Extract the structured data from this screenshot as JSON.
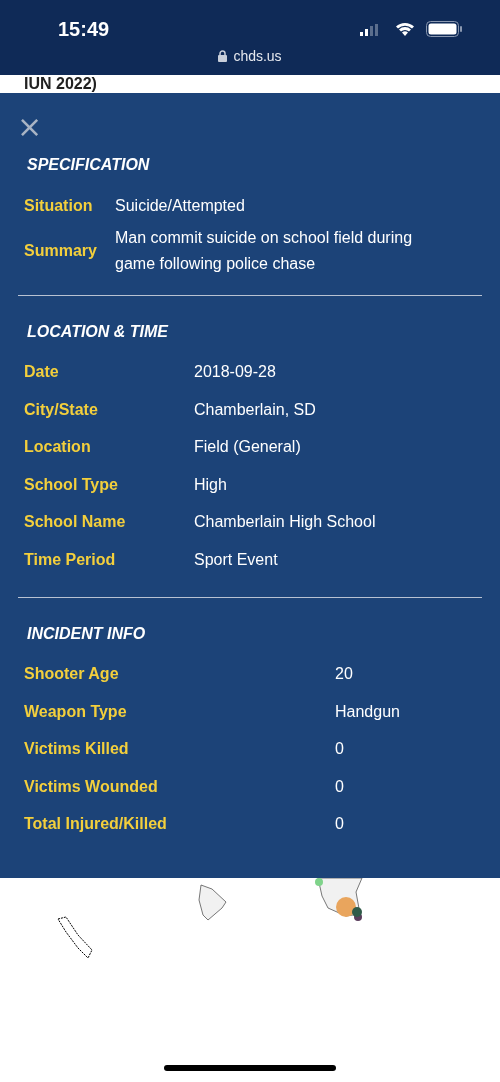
{
  "status_bar": {
    "time": "15:49",
    "url": "chds.us"
  },
  "page_title_fragment": "IUN 2022)",
  "modal": {
    "close": "×",
    "sections": [
      {
        "title": "SPECIFICATION",
        "kind": "summary",
        "rows": [
          {
            "label": "Situation",
            "value": "Suicide/Attempted"
          },
          {
            "label": "Summary",
            "value": "Man commit suicide on school field during game following police chase"
          }
        ]
      },
      {
        "title": "LOCATION & TIME",
        "kind": "details",
        "rows": [
          {
            "label": "Date",
            "value": "2018-09-28"
          },
          {
            "label": "City/State",
            "value": "Chamberlain, SD"
          },
          {
            "label": "Location",
            "value": "Field (General)"
          },
          {
            "label": "School Type",
            "value": "High"
          },
          {
            "label": "School Name",
            "value": "Chamberlain High School"
          },
          {
            "label": "Time Period",
            "value": "Sport Event"
          }
        ]
      },
      {
        "title": "INCIDENT INFO",
        "kind": "counts",
        "rows": [
          {
            "label": "Shooter Age",
            "value": "20"
          },
          {
            "label": "Weapon Type",
            "value": "Handgun"
          },
          {
            "label": "Victims Killed",
            "value": "0"
          },
          {
            "label": "Victims Wounded",
            "value": "0"
          },
          {
            "label": "Total Injured/Killed",
            "value": "0"
          }
        ]
      }
    ]
  }
}
